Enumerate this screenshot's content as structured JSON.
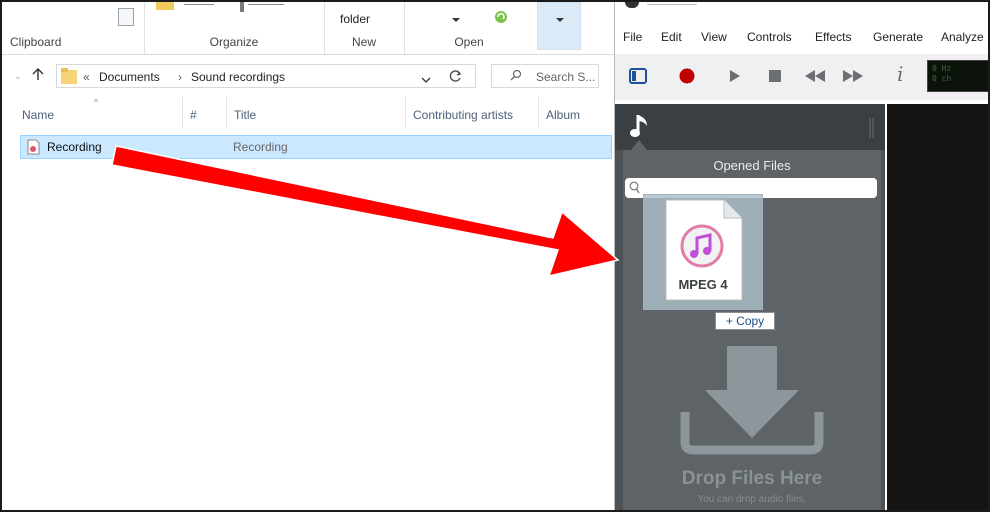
{
  "explorer": {
    "ribbon": {
      "groups": {
        "clipboard": "Clipboard",
        "organize": "Organize",
        "new": "New",
        "open": "Open"
      },
      "new_item_partial": "folder"
    },
    "address": {
      "overflow": "«",
      "path": [
        "Documents",
        "Sound recordings"
      ],
      "separator": "›"
    },
    "search": {
      "placeholder": "Search S..."
    },
    "columns": {
      "name": "Name",
      "number": "#",
      "title": "Title",
      "artists": "Contributing artists",
      "album": "Album"
    },
    "files": [
      {
        "name": "Recording",
        "title": "Recording"
      }
    ]
  },
  "ocenaudio": {
    "menu": [
      "File",
      "Edit",
      "View",
      "Controls",
      "Effects",
      "Generate",
      "Analyze"
    ],
    "display": {
      "line1": "0 Hz",
      "line2": "0 ch"
    },
    "sidebar": {
      "panel_title": "Opened Files",
      "drop_title": "Drop Files Here",
      "drop_subtitle": "You can drop audio files,"
    }
  },
  "drag": {
    "file_type": "MPEG 4",
    "action": "+ Copy"
  },
  "colors": {
    "accent_arrow": "#ff0000",
    "selection": "#cce8ff",
    "sidebar": "#4c5256",
    "record": "#c00000"
  },
  "icons": [
    "folder-icon",
    "refresh-icon",
    "search-icon",
    "audio-file-icon",
    "music-note-icon",
    "play-icon",
    "stop-icon",
    "rewind-icon",
    "fast-forward-icon",
    "info-icon",
    "download-tray-icon"
  ]
}
